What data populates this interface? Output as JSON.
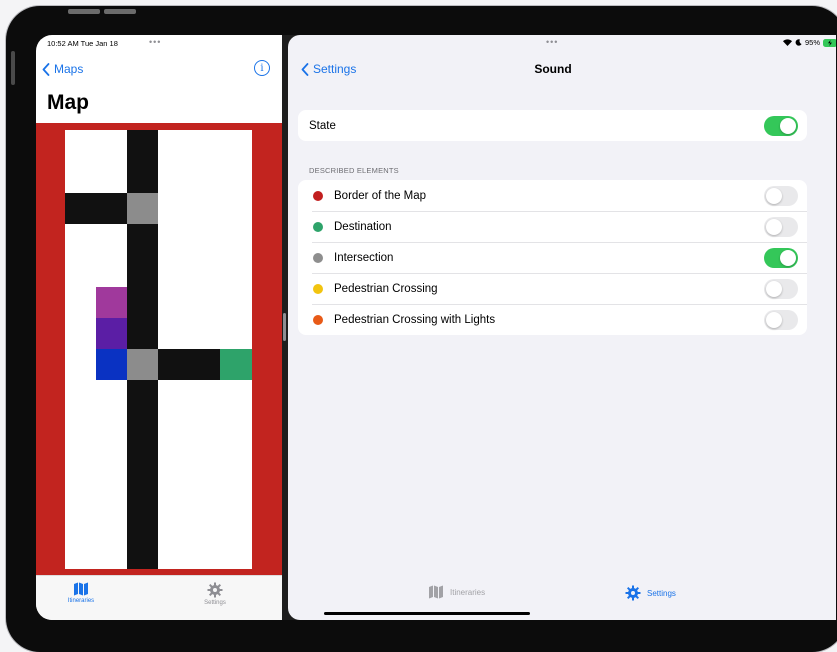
{
  "status": {
    "time": "10:52 AM  Tue Jan 18",
    "left_dots": "•••",
    "right_dots": "•••",
    "battery": "95%"
  },
  "left": {
    "back_label": "Maps",
    "info_glyph": "i",
    "title": "Map",
    "map": {
      "columns": 6,
      "rows": 14,
      "grid": [
        [
          "W",
          "W",
          "B",
          "W",
          "W",
          "W"
        ],
        [
          "W",
          "W",
          "B",
          "W",
          "W",
          "W"
        ],
        [
          "B",
          "B",
          "G",
          "W",
          "W",
          "W"
        ],
        [
          "W",
          "W",
          "B",
          "W",
          "W",
          "W"
        ],
        [
          "W",
          "W",
          "B",
          "W",
          "W",
          "W"
        ],
        [
          "W",
          "P",
          "B",
          "W",
          "W",
          "W"
        ],
        [
          "W",
          "V",
          "B",
          "W",
          "W",
          "W"
        ],
        [
          "W",
          "N",
          "G",
          "B",
          "B",
          "T"
        ],
        [
          "W",
          "W",
          "B",
          "W",
          "W",
          "W"
        ],
        [
          "W",
          "W",
          "B",
          "W",
          "W",
          "W"
        ],
        [
          "W",
          "W",
          "B",
          "W",
          "W",
          "W"
        ],
        [
          "W",
          "W",
          "B",
          "W",
          "W",
          "W"
        ],
        [
          "W",
          "W",
          "B",
          "W",
          "W",
          "W"
        ],
        [
          "W",
          "W",
          "B",
          "W",
          "W",
          "W"
        ]
      ],
      "colors": {
        "border": "#c2241f",
        "W": "#ffffff",
        "B": "#111111",
        "G": "#8c8c8c",
        "P": "#a0399c",
        "V": "#5b1ea5",
        "N": "#0a32c2",
        "T": "#2ea36a"
      }
    },
    "tabs": [
      {
        "label": "Itineraries",
        "icon": "map-icon",
        "selected": true
      },
      {
        "label": "Settings",
        "icon": "gear-icon",
        "selected": false
      }
    ]
  },
  "right": {
    "back_label": "Settings",
    "title": "Sound",
    "state_row": {
      "label": "State",
      "on": true
    },
    "section_header": "DESCRIBED ELEMENTS",
    "elements": [
      {
        "label": "Border of the Map",
        "color": "#c21f1f",
        "on": false
      },
      {
        "label": "Destination",
        "color": "#2ea36a",
        "on": false
      },
      {
        "label": "Intersection",
        "color": "#8e8e8e",
        "on": true
      },
      {
        "label": "Pedestrian Crossing",
        "color": "#f2c40f",
        "on": false
      },
      {
        "label": "Pedestrian Crossing with Lights",
        "color": "#e85a17",
        "on": false
      }
    ],
    "tabs": [
      {
        "label": "Itineraries",
        "icon": "map-icon",
        "selected": false
      },
      {
        "label": "Settings",
        "icon": "gear-icon",
        "selected": true
      }
    ]
  },
  "accent": "#1a73e8",
  "toggle_on_color": "#34c759"
}
